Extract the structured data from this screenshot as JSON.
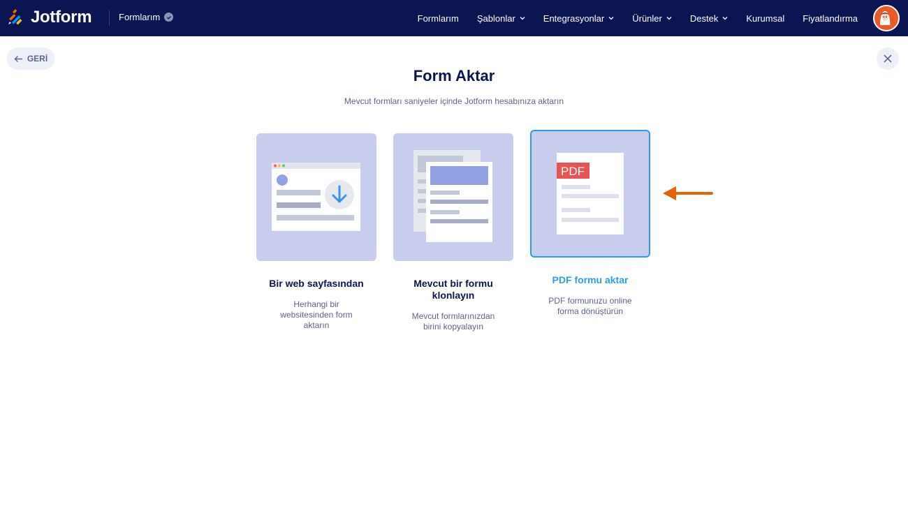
{
  "header": {
    "logo_text": "Jotform",
    "breadcrumb": "Formlarım",
    "nav": [
      {
        "label": "Formlarım",
        "has_dropdown": false
      },
      {
        "label": "Şablonlar",
        "has_dropdown": true
      },
      {
        "label": "Entegrasyonlar",
        "has_dropdown": true
      },
      {
        "label": "Ürünler",
        "has_dropdown": true
      },
      {
        "label": "Destek",
        "has_dropdown": true
      },
      {
        "label": "Kurumsal",
        "has_dropdown": false
      },
      {
        "label": "Fiyatlandırma",
        "has_dropdown": false
      }
    ],
    "colors": {
      "background": "#0a1551",
      "avatar": "#e85a28"
    }
  },
  "back_button": {
    "label": "GERİ"
  },
  "page": {
    "title": "Form Aktar",
    "subtitle": "Mevcut formları saniyeler içinde Jotform hesabınıza aktarın"
  },
  "cards": [
    {
      "title": "Bir web sayfasından",
      "description": "Herhangi bir websitesinden form aktarın",
      "selected": false
    },
    {
      "title": "Mevcut bir formu klonlayın",
      "description": "Mevcut formlarınızdan birini kopyalayın",
      "selected": false
    },
    {
      "title": "PDF formu aktar",
      "description": "PDF formunuzu online forma dönüştürün",
      "selected": true,
      "badge": "PDF"
    }
  ],
  "colors": {
    "accent": "#2d9bf0",
    "card_bg": "#c8cdee",
    "pointer_arrow": "#e8610f"
  }
}
